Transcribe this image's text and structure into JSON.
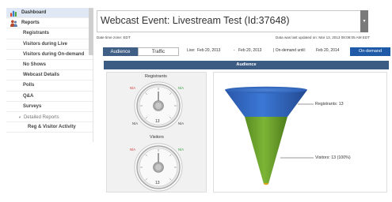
{
  "sidebar": {
    "dashboard": "Dashboard",
    "reports": "Reports",
    "items": [
      "Registrants",
      "Visitors during Live",
      "Visitors during On-demand",
      "No Shows",
      "Webcast Details",
      "Polls",
      "Q&A",
      "Surveys"
    ],
    "group": "Detailed Reports",
    "group_items": [
      "Reg & Visitor Activity"
    ]
  },
  "header": {
    "title": "Webcast Event: Livestream Test (Id:37648)",
    "timezone": "Date time zone: EDT",
    "updated": "Data was last updated on: Mar 13, 2013 08:08:05 AM EDT"
  },
  "tabs": {
    "audience": "Audience",
    "traffic": "Traffic"
  },
  "dates": {
    "live_label": "Live:",
    "live_start": "Feb 20, 2013",
    "dash": "-",
    "live_end": "Feb 20, 2013",
    "ondemand_label": "|  On-demand until:",
    "ondemand_until": "Feb 20, 2014",
    "ondemand_button": "On-demand"
  },
  "section": {
    "audience_title": "Audience"
  },
  "gauges": [
    {
      "title": "Registrants",
      "value": "13",
      "na": "N/A"
    },
    {
      "title": "Visitors",
      "value": "13",
      "na": "N/A"
    }
  ],
  "funnel": {
    "registrants_label": "Registrants: 13",
    "visitors_label": "Visitors: 13 (100%)",
    "colors": {
      "top": "#2f66c2",
      "bottom": "#69a12a",
      "tip": "#e0a41c"
    }
  }
}
